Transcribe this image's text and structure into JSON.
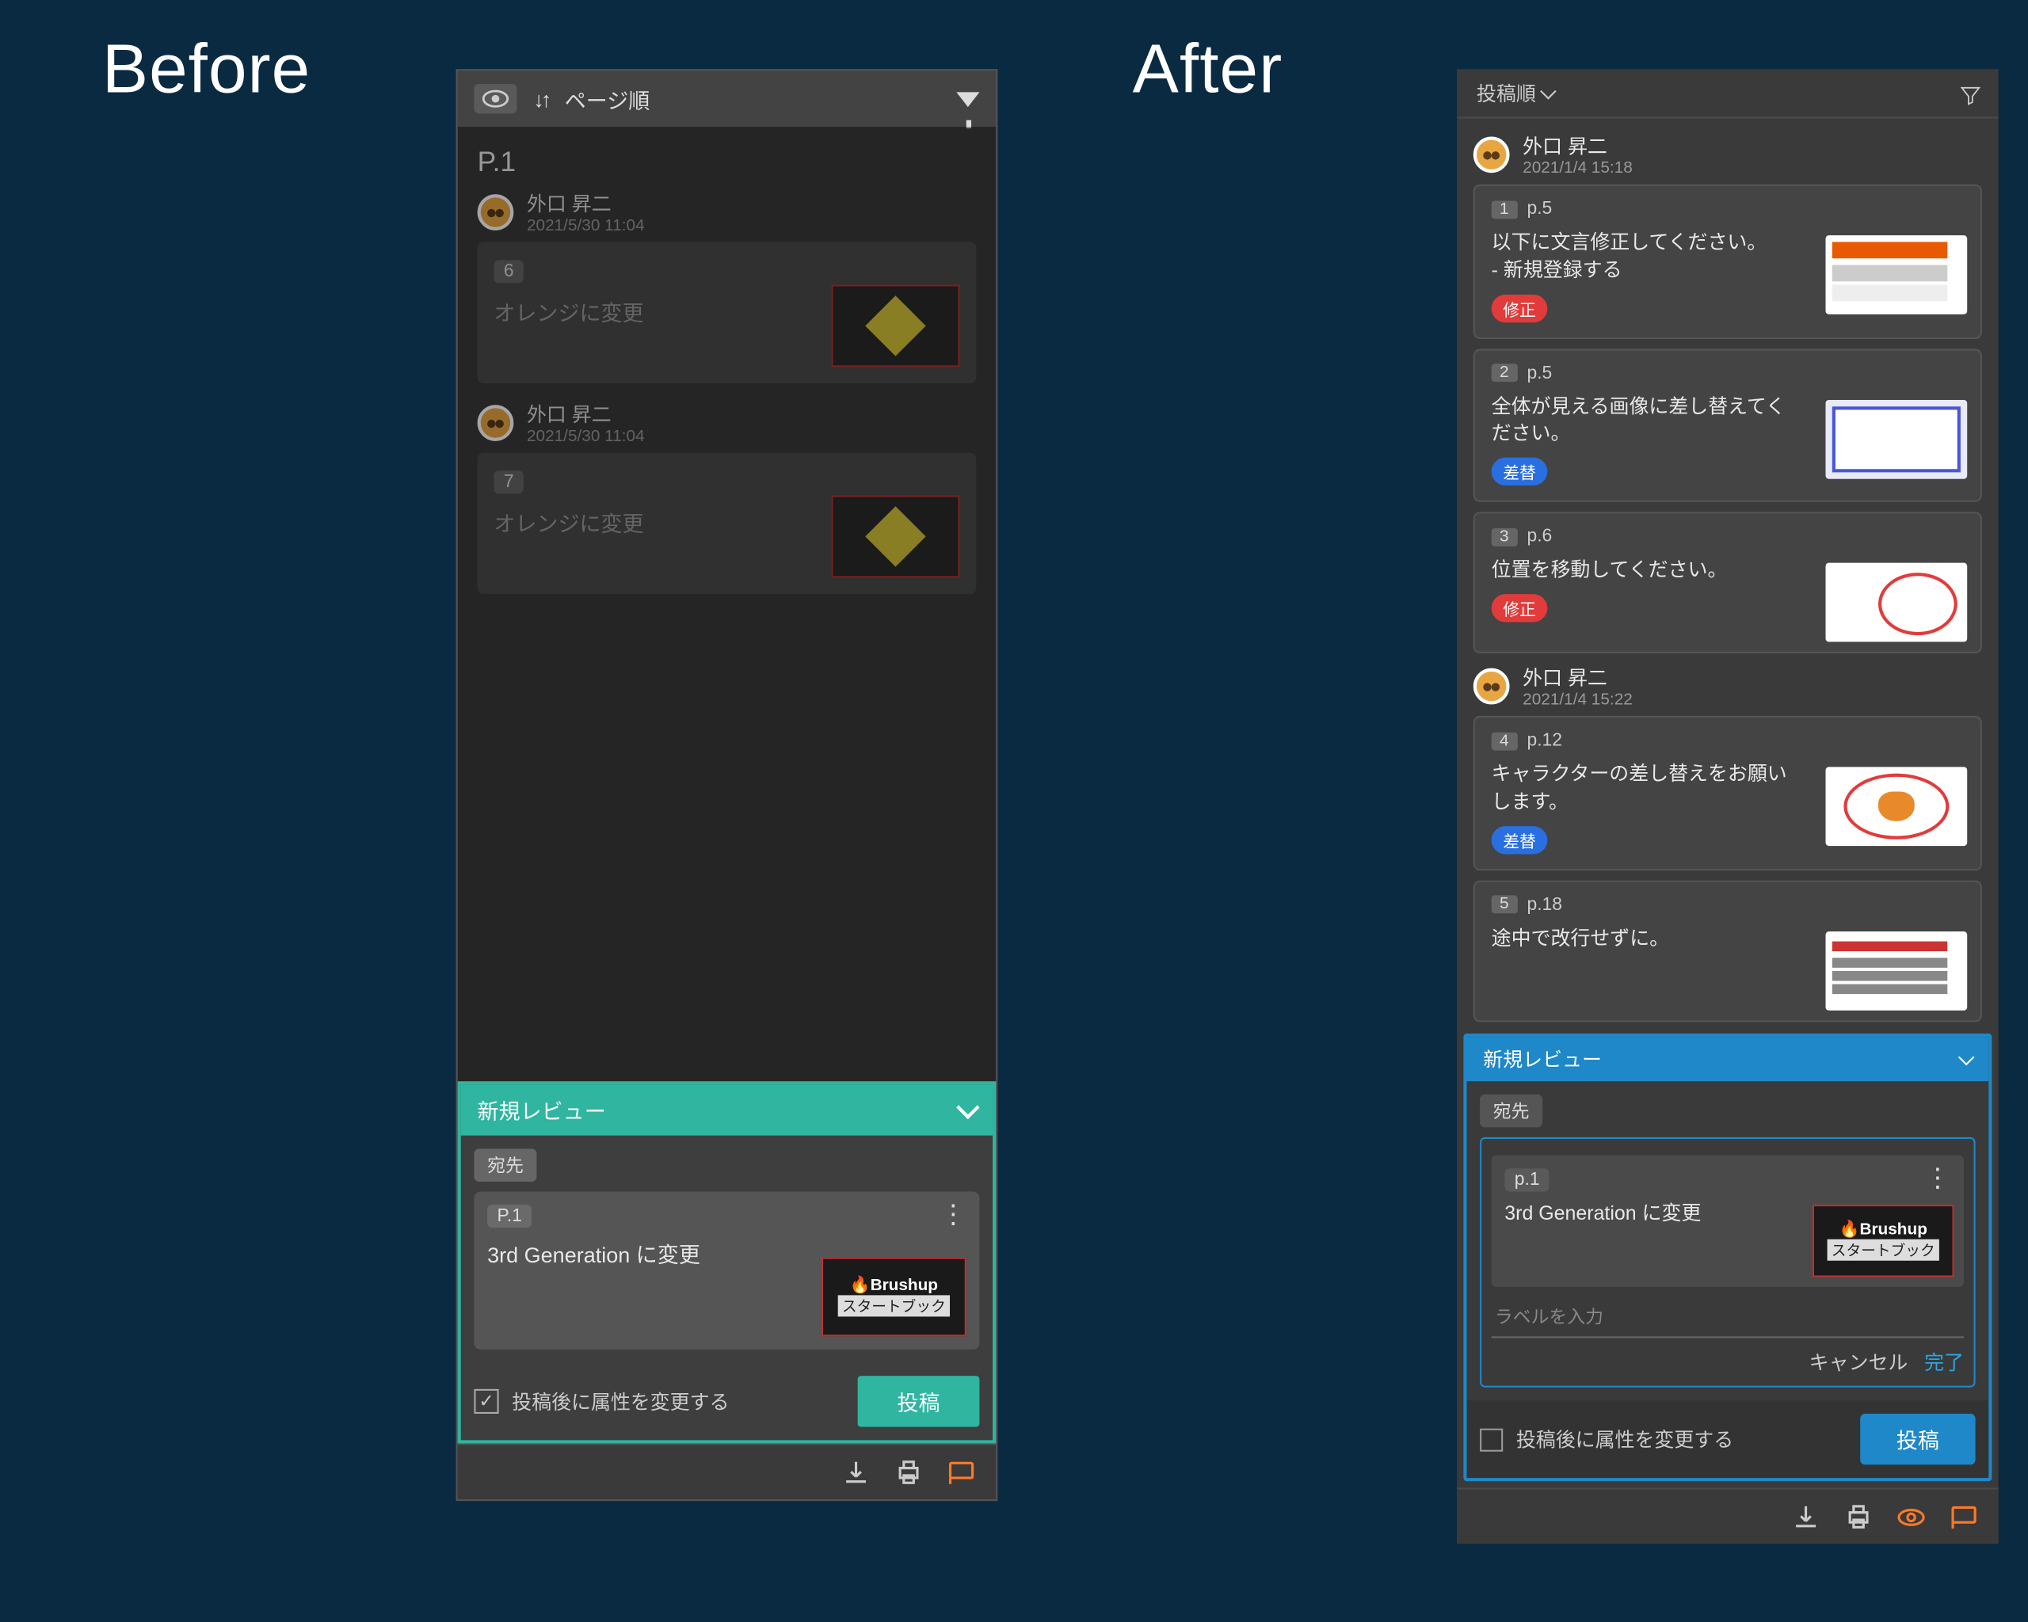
{
  "labels": {
    "before": "Before",
    "after": "After"
  },
  "before": {
    "topbar": {
      "sort_label": "ページ順"
    },
    "page_title": "P.1",
    "comments": [
      {
        "author": "外口 昇二",
        "timestamp": "2021/5/30 11:04",
        "badge": "6",
        "text": "オレンジに変更"
      },
      {
        "author": "外口 昇二",
        "timestamp": "2021/5/30 11:04",
        "badge": "7",
        "text": "オレンジに変更"
      }
    ],
    "compose": {
      "title": "新規レビュー",
      "to_label": "宛先",
      "page_badge": "P.1",
      "text": "3rd Generation に変更",
      "thumb_brand": "Brushup",
      "thumb_sub": "スタートブック",
      "footer_checkbox_label": "投稿後に属性を変更する",
      "footer_checked": true,
      "post_label": "投稿"
    }
  },
  "after": {
    "topbar": {
      "sort_label": "投稿順"
    },
    "groups": [
      {
        "author": "外口 昇二",
        "timestamp": "2021/1/4 15:18",
        "cards": [
          {
            "num": "1",
            "page": "p.5",
            "text": "以下に文言修正してください。\n- 新規登録する",
            "tag": "修正",
            "tag_color": "red",
            "thumb": "t1"
          },
          {
            "num": "2",
            "page": "p.5",
            "text": "全体が見える画像に差し替えてください。",
            "tag": "差替",
            "tag_color": "blue",
            "thumb": "t2"
          },
          {
            "num": "3",
            "page": "p.6",
            "text": "位置を移動してください。",
            "tag": "修正",
            "tag_color": "red",
            "thumb": "t3"
          }
        ]
      },
      {
        "author": "外口 昇二",
        "timestamp": "2021/1/4 15:22",
        "cards": [
          {
            "num": "4",
            "page": "p.12",
            "text": "キャラクターの差し替えをお願いします。",
            "tag": "差替",
            "tag_color": "blue",
            "thumb": "t4"
          },
          {
            "num": "5",
            "page": "p.18",
            "text": "途中で改行せずに。",
            "tag": "",
            "tag_color": "",
            "thumb": "t5"
          }
        ]
      }
    ],
    "compose": {
      "title": "新規レビュー",
      "to_label": "宛先",
      "page_badge": "p.1",
      "text": "3rd Generation に変更",
      "thumb_brand": "Brushup",
      "thumb_sub": "スタートブック",
      "label_placeholder": "ラベルを入力",
      "cancel": "キャンセル",
      "done": "完了",
      "footer_checkbox_label": "投稿後に属性を変更する",
      "footer_checked": false,
      "post_label": "投稿"
    }
  }
}
